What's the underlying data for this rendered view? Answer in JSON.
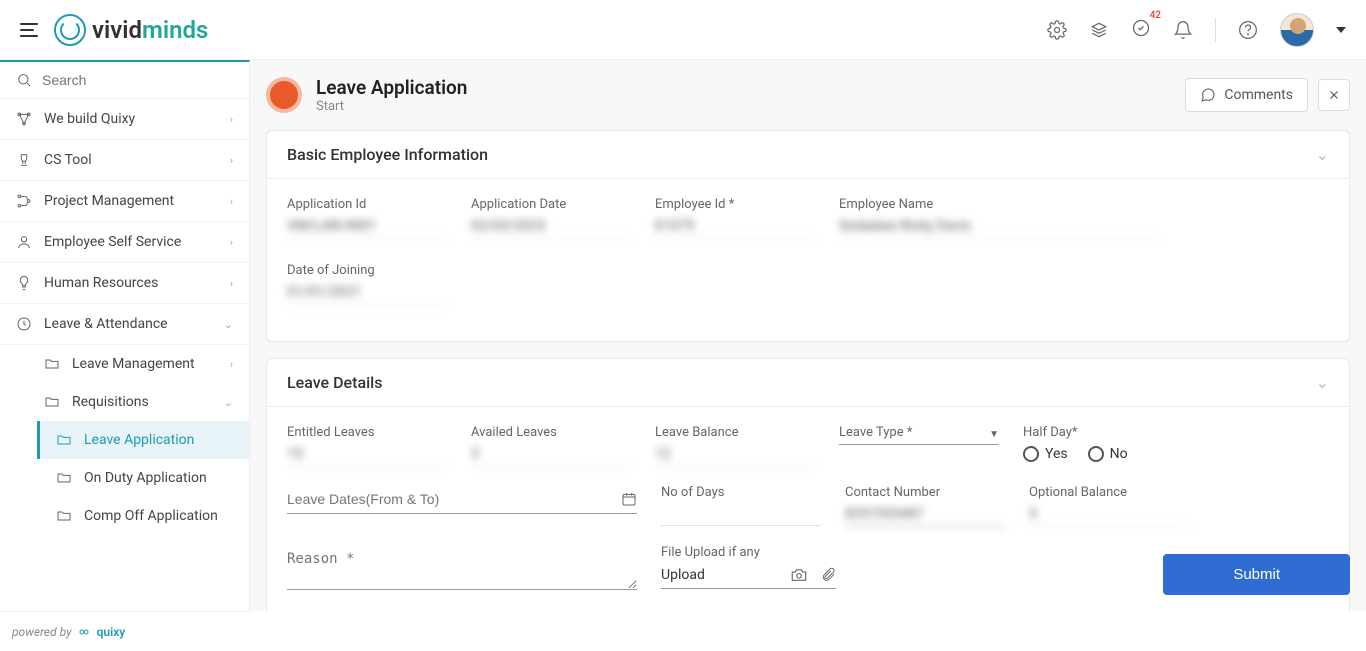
{
  "header": {
    "logo_part1": "vivid",
    "logo_part2": "minds",
    "badge_count": "42"
  },
  "sidebar": {
    "search_placeholder": "Search",
    "items": [
      {
        "label": "We build Quixy"
      },
      {
        "label": "CS Tool"
      },
      {
        "label": "Project Management"
      },
      {
        "label": "Employee Self Service"
      },
      {
        "label": "Human Resources"
      },
      {
        "label": "Leave & Attendance"
      }
    ],
    "sub_items": [
      {
        "label": "Leave Management"
      },
      {
        "label": "Requisitions"
      }
    ],
    "sub2_items": [
      {
        "label": "Leave Application"
      },
      {
        "label": "On Duty Application"
      },
      {
        "label": "Comp Off Application"
      }
    ]
  },
  "page": {
    "title": "Leave Application",
    "subtitle": "Start",
    "comments_label": "Comments"
  },
  "sections": {
    "basic": {
      "title": "Basic Employee Information",
      "app_id_label": "Application Id",
      "app_id_value": "VM/LAR/4001",
      "app_date_label": "Application Date",
      "app_date_value": "02/03/2023",
      "emp_id_label": "Employee Id *",
      "emp_id_value": "E1075",
      "emp_name_label": "Employee Name",
      "emp_name_value": "Sodadasi Ricky Davis",
      "doj_label": "Date of Joining",
      "doj_value": "01/01/2021"
    },
    "leave": {
      "title": "Leave Details",
      "entitled_label": "Entitled Leaves",
      "entitled_value": "15",
      "availed_label": "Availed Leaves",
      "availed_value": "3",
      "balance_label": "Leave Balance",
      "balance_value": "12",
      "type_label": "Leave Type *",
      "halfday_label": "Half Day*",
      "yes": "Yes",
      "no": "No",
      "dates_label": "Leave Dates(From & To)",
      "days_label": "No of Days",
      "contact_label": "Contact Number",
      "contact_value": "8297353487",
      "optional_label": "Optional Balance",
      "optional_value": "5",
      "reason_label": "Reason *",
      "upload_label": "File Upload if any",
      "upload_text": "Upload"
    }
  },
  "actions": {
    "submit": "Submit"
  },
  "footer": {
    "powered": "powered by",
    "brand": "quixy"
  }
}
